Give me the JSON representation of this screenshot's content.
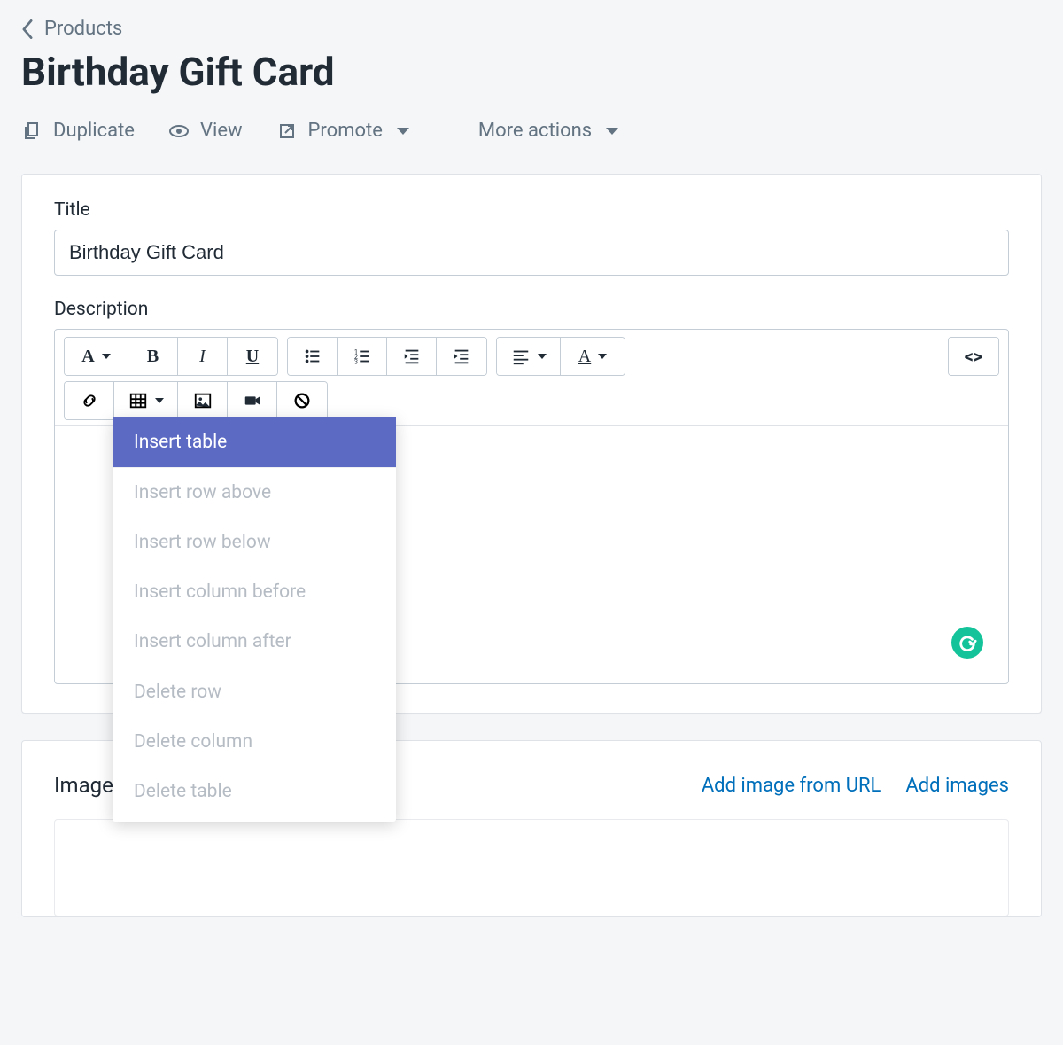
{
  "breadcrumb": {
    "label": "Products"
  },
  "page_title": "Birthday Gift Card",
  "actions": {
    "duplicate": "Duplicate",
    "view": "View",
    "promote": "Promote",
    "more": "More actions"
  },
  "title_field": {
    "label": "Title",
    "value": "Birthday Gift Card"
  },
  "description": {
    "label": "Description",
    "toolbar": {
      "font": "A",
      "bold": "B",
      "italic": "I",
      "underline": "U",
      "textcolor": "A",
      "code": "<>"
    },
    "table_menu": {
      "items": [
        {
          "label": "Insert table",
          "highlight": true,
          "sep_after": true
        },
        {
          "label": "Insert row above",
          "disabled": true
        },
        {
          "label": "Insert row below",
          "disabled": true
        },
        {
          "label": "Insert column before",
          "disabled": true
        },
        {
          "label": "Insert column after",
          "disabled": true,
          "sep_after": true
        },
        {
          "label": "Delete row",
          "disabled": true
        },
        {
          "label": "Delete column",
          "disabled": true
        },
        {
          "label": "Delete table",
          "disabled": true
        }
      ]
    }
  },
  "images": {
    "title": "Images",
    "add_url": "Add image from URL",
    "add_images": "Add images"
  },
  "colors": {
    "accent": "#5c6ac4",
    "link": "#006fbb",
    "grammarly": "#15c39a"
  }
}
